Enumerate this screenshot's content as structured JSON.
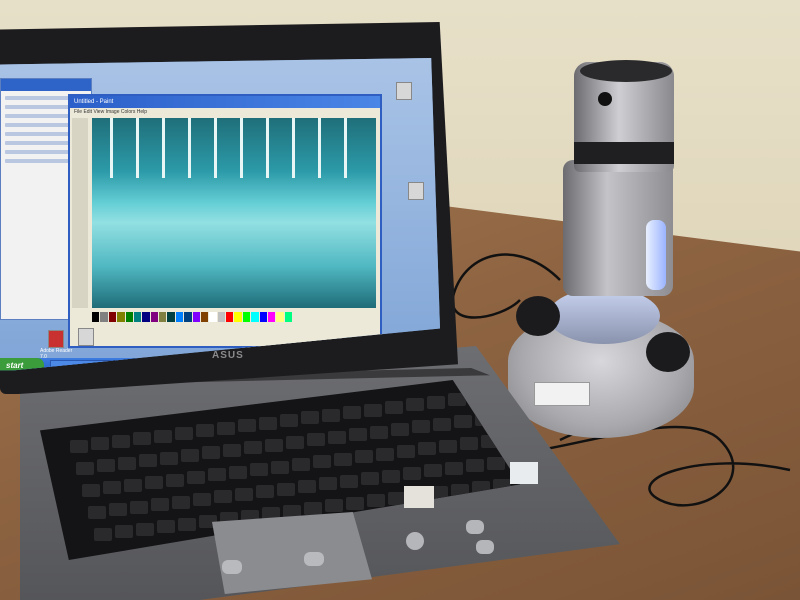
{
  "scene": {
    "description": "",
    "laptop_brand": "ASUS"
  },
  "screen": {
    "paint_window_title": "Untitled - Paint",
    "paint_menu": "File Edit View Image Colors Help",
    "start_label": "start",
    "taskbar_items": [
      "",
      ""
    ],
    "desktop_icons": [
      {
        "label": "Adobe Reader 7.0",
        "icon": "pdf-icon"
      },
      {
        "label": "",
        "icon": "file-icon"
      }
    ]
  },
  "colors": {
    "palette": [
      "#000000",
      "#808080",
      "#800000",
      "#808000",
      "#008000",
      "#008080",
      "#000080",
      "#800080",
      "#808040",
      "#004040",
      "#0080ff",
      "#004080",
      "#8000ff",
      "#804000",
      "#ffffff",
      "#c0c0c0",
      "#ff0000",
      "#ffff00",
      "#00ff00",
      "#00ffff",
      "#0000ff",
      "#ff00ff",
      "#ffff80",
      "#00ff80"
    ]
  }
}
